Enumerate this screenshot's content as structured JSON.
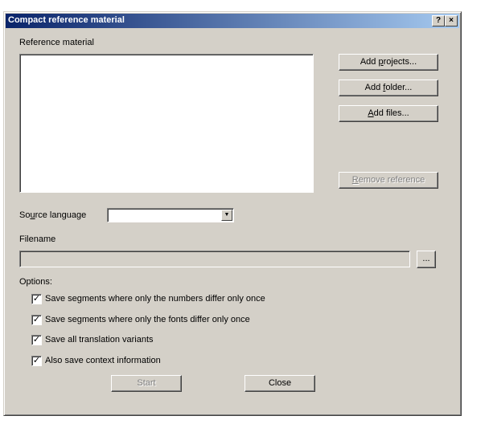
{
  "window": {
    "title": "Compact reference material",
    "help_glyph": "?",
    "close_glyph": "×"
  },
  "reference": {
    "label": "Reference material",
    "items": []
  },
  "buttons": {
    "add_projects": "Add projects...",
    "add_folder": "Add folder...",
    "add_files": "Add files...",
    "remove_reference": "Remove reference",
    "browse": "...",
    "start": "Start",
    "close": "Close"
  },
  "source_language": {
    "label": "Source language",
    "value": ""
  },
  "filename": {
    "label": "Filename",
    "value": ""
  },
  "options": {
    "label": "Options:",
    "items": [
      {
        "label": "Save segments where only the numbers differ only once",
        "checked": true
      },
      {
        "label": "Save segments where only the fonts differ only once",
        "checked": true
      },
      {
        "label": "Save all translation variants",
        "checked": true
      },
      {
        "label": "Also save context information",
        "checked": true
      }
    ]
  },
  "colors": {
    "title_gradient_start": "#0a246a",
    "title_gradient_end": "#a6caf0",
    "dialog_face": "#d4d0c8"
  }
}
